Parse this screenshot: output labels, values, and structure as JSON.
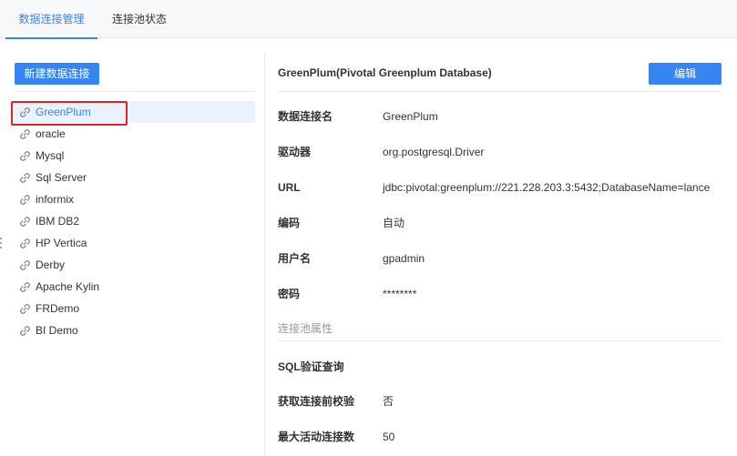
{
  "tabs": [
    {
      "label": "数据连接管理",
      "active": true
    },
    {
      "label": "连接池状态",
      "active": false
    }
  ],
  "left": {
    "new_button": "新建数据连接",
    "connections": [
      {
        "name": "GreenPlum",
        "selected": true
      },
      {
        "name": "oracle"
      },
      {
        "name": "Mysql"
      },
      {
        "name": "Sql Server"
      },
      {
        "name": "informix"
      },
      {
        "name": "IBM DB2"
      },
      {
        "name": "HP Vertica"
      },
      {
        "name": "Derby"
      },
      {
        "name": "Apache Kylin"
      },
      {
        "name": "FRDemo"
      },
      {
        "name": "BI Demo"
      }
    ]
  },
  "right": {
    "title": "GreenPlum(Pivotal Greenplum Database)",
    "edit_button": "编辑",
    "fields": [
      {
        "label": "数据连接名",
        "value": "GreenPlum"
      },
      {
        "label": "驱动器",
        "value": "org.postgresql.Driver"
      },
      {
        "label": "URL",
        "value": "jdbc:pivotal:greenplum://221.228.203.3:5432;DatabaseName=lance"
      },
      {
        "label": "编码",
        "value": "自动"
      },
      {
        "label": "用户名",
        "value": "gpadmin"
      },
      {
        "label": "密码",
        "value": "********"
      }
    ],
    "pool_section_label": "连接池属性",
    "pool_fields": [
      {
        "label": "SQL验证查询",
        "value": ""
      },
      {
        "label": "获取连接前校验",
        "value": "否"
      },
      {
        "label": "最大活动连接数",
        "value": "50"
      }
    ]
  },
  "colors": {
    "accent": "#3685f2",
    "highlight_border": "#e52222"
  }
}
